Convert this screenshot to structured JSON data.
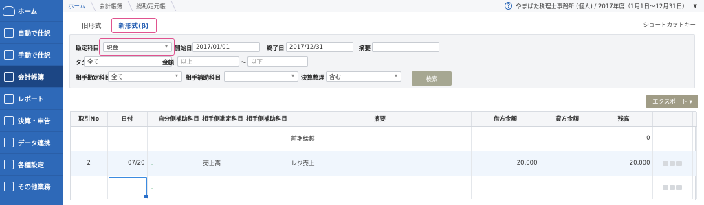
{
  "sidebar": {
    "items": [
      {
        "label": "ホーム",
        "icon": "cloud-mf-icon",
        "active": false
      },
      {
        "label": "自動で仕訳",
        "icon": "auto-journal-icon",
        "active": false
      },
      {
        "label": "手動で仕訳",
        "icon": "manual-journal-icon",
        "active": false
      },
      {
        "label": "会計帳簿",
        "icon": "book-icon",
        "active": true
      },
      {
        "label": "レポート",
        "icon": "chart-icon",
        "active": false
      },
      {
        "label": "決算・申告",
        "icon": "document-icon",
        "active": false
      },
      {
        "label": "データ連携",
        "icon": "data-link-icon",
        "active": false
      },
      {
        "label": "各種設定",
        "icon": "gear-icon",
        "active": false
      },
      {
        "label": "その他業務",
        "icon": "list-icon",
        "active": false
      }
    ]
  },
  "breadcrumb": [
    "ホーム",
    "会計帳簿",
    "総勘定元帳"
  ],
  "header": {
    "help_glyph": "?",
    "org": "やまばた税理士事務所 (個人) / 2017年度（1月1日〜12月31日）"
  },
  "tabs": [
    {
      "label": "旧形式",
      "active": false
    },
    {
      "label": "新形式(β)",
      "active": true
    }
  ],
  "shortcut_label": "ショートカットキー",
  "filter": {
    "account_label": "勘定科目",
    "account_value": "現金",
    "start_label": "開始日",
    "start_value": "2017/01/01",
    "end_label": "終了日",
    "end_value": "2017/12/31",
    "memo_label": "摘要",
    "memo_value": "",
    "tag_label": "タグ",
    "tag_value": "全て",
    "amount_label": "金額",
    "amount_min_placeholder": "以上",
    "amount_tilde": "〜",
    "amount_max_placeholder": "以下",
    "counter_account_label": "相手勘定科目",
    "counter_account_value": "全て",
    "counter_sub_label": "相手補助科目",
    "counter_sub_value": "",
    "closing_label": "決算整理",
    "closing_value": "含む",
    "search_button": "検索"
  },
  "export_button": "エクスポート ▾",
  "table": {
    "headers": [
      "取引No",
      "日付",
      "",
      "自分側補助科目",
      "相手側勘定科目",
      "相手側補助科目",
      "摘要",
      "借方金額",
      "貸方金額",
      "残高",
      "",
      ""
    ],
    "rows": [
      {
        "no": "",
        "date": "",
        "own_sub": "",
        "counter_account": "",
        "counter_sub": "",
        "memo": "前期繰越",
        "debit": "",
        "credit": "",
        "balance": "0"
      },
      {
        "no": "2",
        "date": "07/20",
        "own_sub": "",
        "counter_account": "売上高",
        "counter_sub": "",
        "memo": "レジ売上",
        "debit": "20,000",
        "credit": "",
        "balance": "20,000"
      },
      {
        "no": "",
        "date": "",
        "own_sub": "",
        "counter_account": "",
        "counter_sub": "",
        "memo": "",
        "debit": "",
        "credit": "",
        "balance": ""
      }
    ]
  },
  "colors": {
    "sidebar": "#2e69b8",
    "sidebar_active": "#1c4684",
    "highlight": "#e0538f",
    "search_button": "#a6a792"
  }
}
